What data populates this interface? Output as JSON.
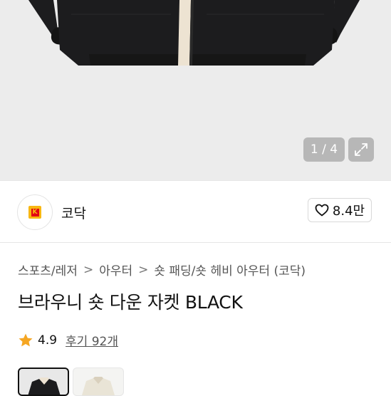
{
  "gallery": {
    "counter": "1 / 4",
    "expand_icon": "expand-icon"
  },
  "brand": {
    "name": "코닥",
    "logo_icon": "kodak-logo",
    "logo_letter": "K",
    "like_count": "8.4만",
    "like_icon": "heart-icon"
  },
  "breadcrumb": {
    "items": [
      "스포츠/레저",
      "아우터",
      "숏 패딩/숏 헤비 아우터 (코닥)"
    ],
    "separator": ">"
  },
  "product": {
    "title": "브라우니 숏 다운 자켓 BLACK",
    "rating": "4.9",
    "review_label": "후기 92개",
    "star_icon": "star-icon"
  },
  "colors": {
    "kodak_yellow": "#f8b712",
    "kodak_red": "#e30613",
    "star": "#f5a623",
    "jacket": "#1c1c1e",
    "lining": "#ede3d2"
  }
}
